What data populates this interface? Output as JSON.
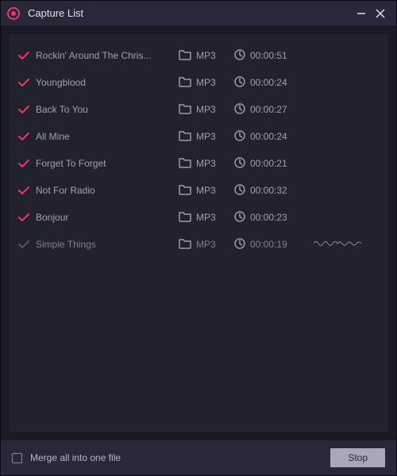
{
  "window": {
    "title": "Capture List"
  },
  "tracks": [
    {
      "name": "Rockin' Around The Chris...",
      "format": "MP3",
      "duration": "00:00:51",
      "done": true
    },
    {
      "name": "Youngblood",
      "format": "MP3",
      "duration": "00:00:24",
      "done": true
    },
    {
      "name": "Back To You",
      "format": "MP3",
      "duration": "00:00:27",
      "done": true
    },
    {
      "name": "All Mine",
      "format": "MP3",
      "duration": "00:00:24",
      "done": true
    },
    {
      "name": "Forget To Forget",
      "format": "MP3",
      "duration": "00:00:21",
      "done": true
    },
    {
      "name": "Not For Radio",
      "format": "MP3",
      "duration": "00:00:32",
      "done": true
    },
    {
      "name": "Bonjour",
      "format": "MP3",
      "duration": "00:00:23",
      "done": true
    },
    {
      "name": "Simple Things",
      "format": "MP3",
      "duration": "00:00:19",
      "done": false
    }
  ],
  "footer": {
    "merge_label": "Merge all into one file",
    "stop_label": "Stop"
  },
  "colors": {
    "accent": "#e63968",
    "bg": "#1a1a24",
    "panel": "#22222e",
    "chrome": "#28283a"
  }
}
